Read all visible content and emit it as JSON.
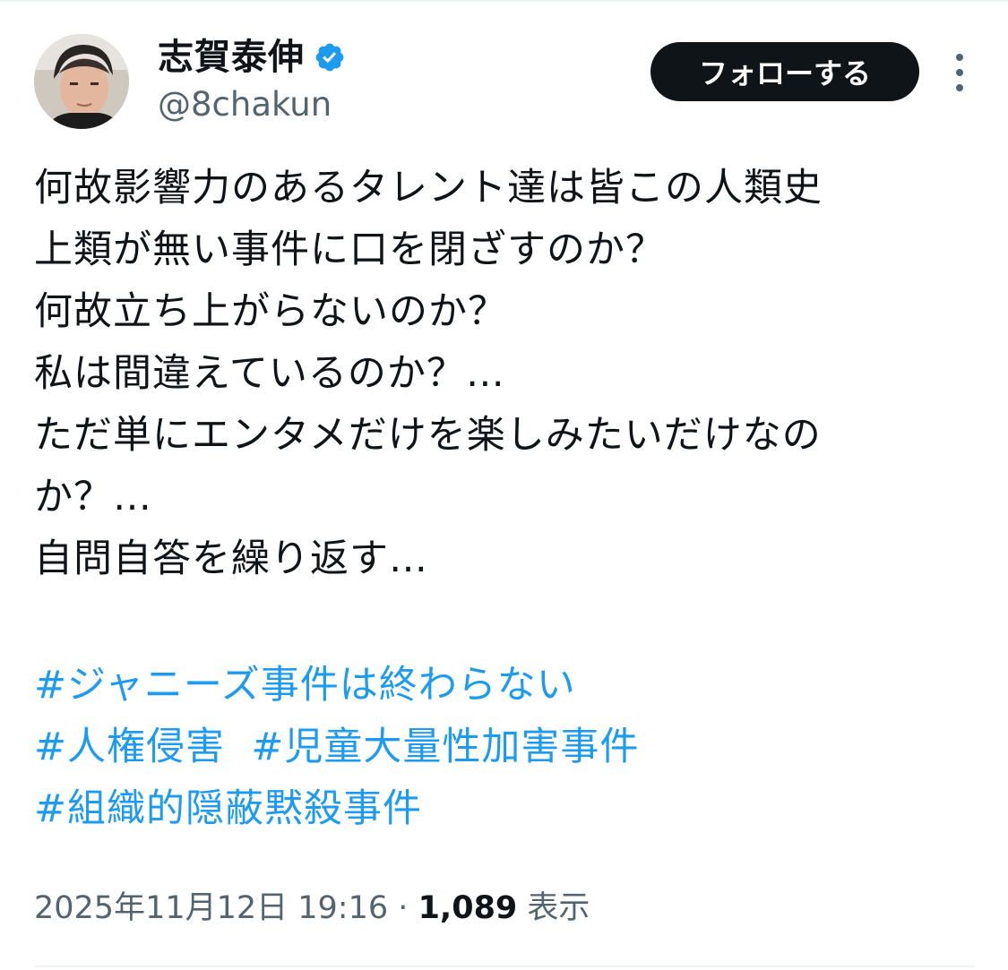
{
  "user": {
    "display_name": "志賀泰伸",
    "handle": "@8chakun",
    "verified": true
  },
  "follow_button": {
    "label": "フォローする"
  },
  "tweet": {
    "lines": [
      "何故影響力のあるタレント達は皆この人類史",
      "上類が無い事件に口を閉ざすのか？",
      "何故立ち上がらないのか？",
      "私は間違えているのか？…",
      "ただ単にエンタメだけを楽しみたいだけなの",
      "か？…",
      "自問自答を繰り返す…"
    ],
    "hashtags": [
      "#ジャニーズ事件は終わらない",
      "#人権侵害",
      "#児童大量性加害事件",
      "#組織的隠蔽黙殺事件"
    ]
  },
  "meta": {
    "date": "2025年11月12日 19:16",
    "separator": "·",
    "views_count": "1,089",
    "views_label": "表示"
  },
  "colors": {
    "text": "#0f1419",
    "secondary": "#536471",
    "link": "#1d9bf0",
    "verified_badge": "#1d9bf0",
    "button_bg": "#0f1419"
  },
  "icons": {
    "verified": "verified-badge-icon",
    "more": "more-options-icon"
  }
}
